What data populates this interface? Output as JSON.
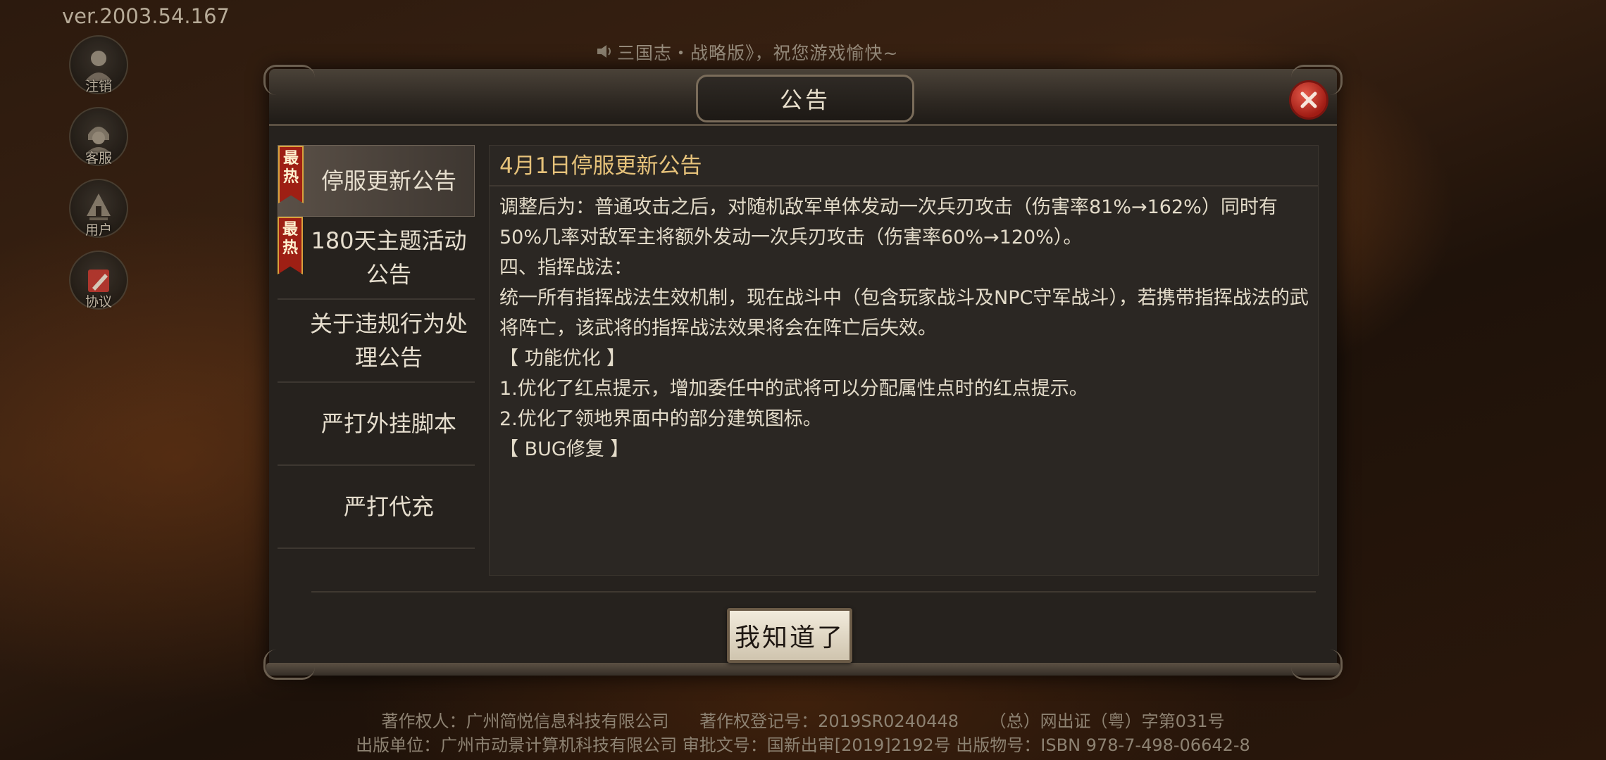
{
  "version": "ver.2003.54.167",
  "side_menu": [
    {
      "label": "注销",
      "icon": "logout-avatar-icon"
    },
    {
      "label": "客服",
      "icon": "customer-service-icon"
    },
    {
      "label": "用户",
      "icon": "user-tent-icon"
    },
    {
      "label": "协议",
      "icon": "agreement-pen-icon"
    }
  ],
  "marquee": "三国志・战略版》，祝您游戏愉快~",
  "dialog": {
    "title": "公告",
    "tabs": [
      {
        "label": "停服更新公告",
        "hot": true,
        "active": true
      },
      {
        "label": "180天主题活动公告",
        "hot": true,
        "active": false
      },
      {
        "label": "关于违规行为处理公告",
        "hot": false,
        "active": false
      },
      {
        "label": "严打外挂脚本",
        "hot": false,
        "active": false
      },
      {
        "label": "严打代充",
        "hot": false,
        "active": false
      }
    ],
    "hot_badge_top": "最",
    "hot_badge_bottom": "热",
    "content_title": "4月1日停服更新公告",
    "content_paragraphs": [
      "调整后为：普通攻击之后，对随机敌军单体发动一次兵刃攻击（伤害率81%→162%）同时有50%几率对敌军主将额外发动一次兵刃攻击（伤害率60%→120%）。",
      "",
      "四、指挥战法：",
      "统一所有指挥战法生效机制，现在战斗中（包含玩家战斗及NPC守军战斗），若携带指挥战法的武将阵亡，该武将的指挥战法效果将会在阵亡后失效。",
      "",
      "【 功能优化 】",
      "1.优化了红点提示，增加委任中的武将可以分配属性点时的红点提示。",
      "2.优化了领地界面中的部分建筑图标。",
      "",
      "【 BUG修复 】"
    ],
    "ok_label": "我知道了"
  },
  "footer": {
    "copyright_owner": "著作权人：广州简悦信息科技有限公司",
    "registration": "著作权登记号：2019SR0240448",
    "license": "（总）网出证（粤）字第031号",
    "publisher": "出版单位：广州市动景计算机科技有限公司 审批文号：国新出审[2019]2192号 出版物号：ISBN 978-7-498-06642-8"
  },
  "colors": {
    "accent_title": "#e6c27a",
    "hot_badge": "#9e1f14",
    "close_button": "#c8342a"
  }
}
